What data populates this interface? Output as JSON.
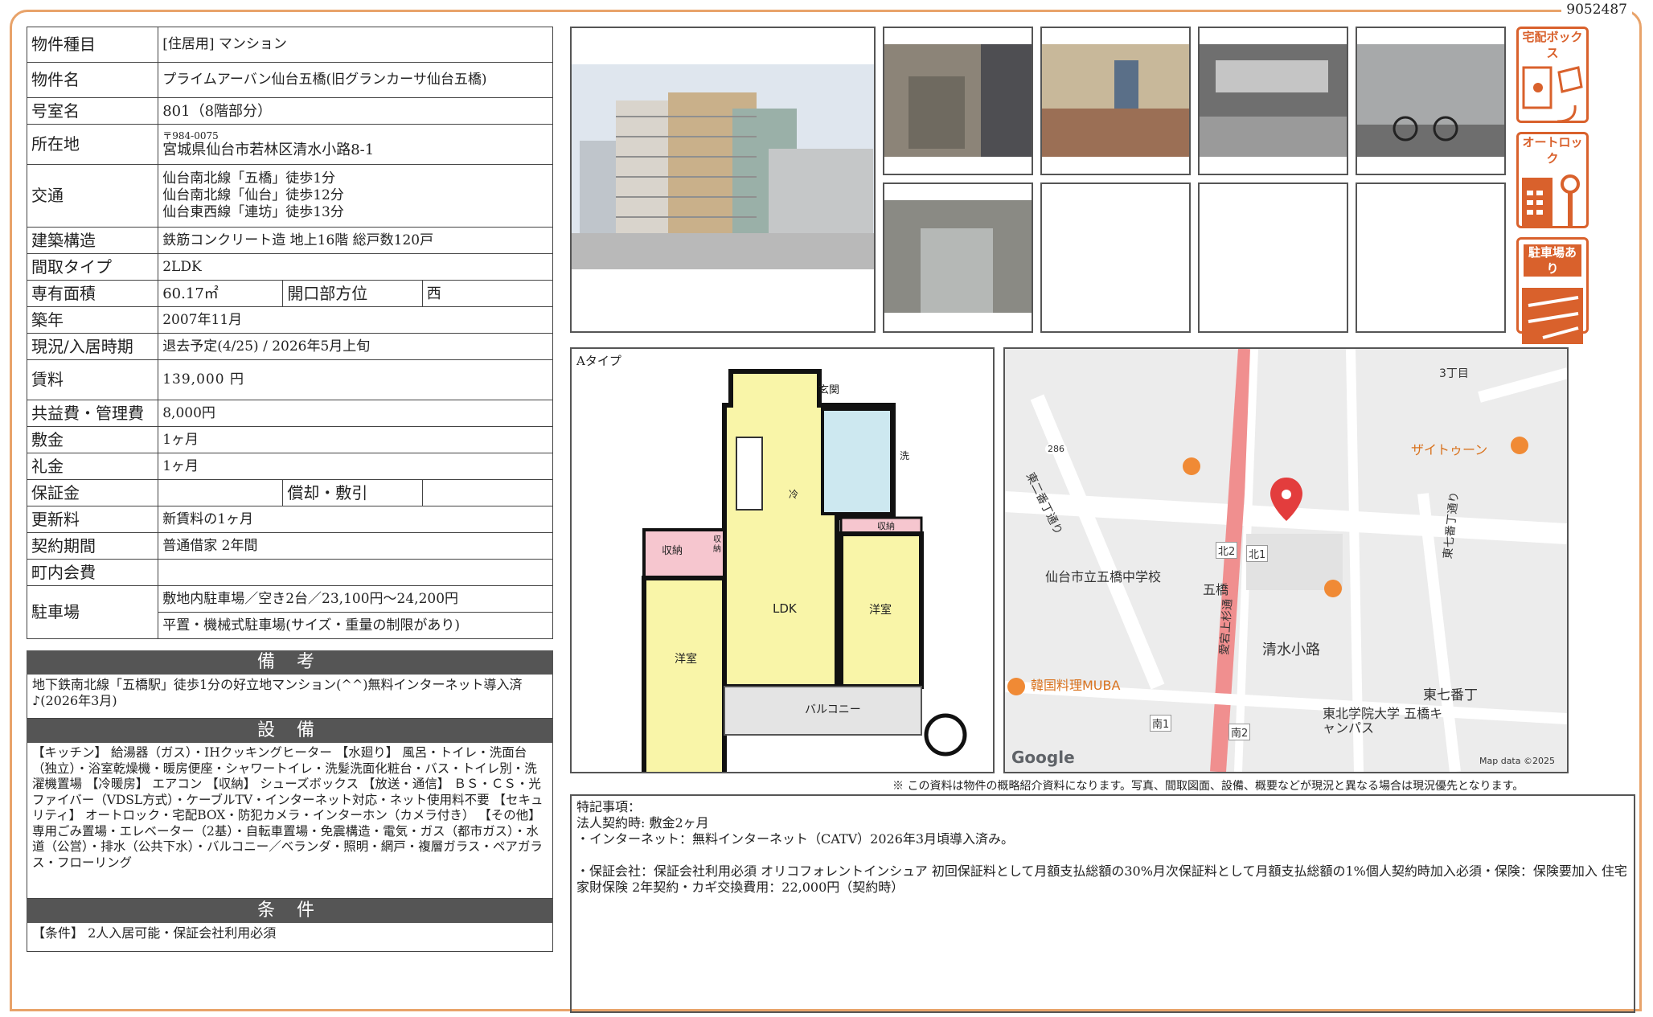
{
  "doc_id": "9052487",
  "spec": {
    "type_label": "物件種目",
    "type_value": "[住居用]  マンション",
    "name_label": "物件名",
    "name_value": "プライムアーバン仙台五橋(旧グランカーサ仙台五橋)",
    "room_label": "号室名",
    "room_value": "801（8階部分）",
    "addr_label": "所在地",
    "postal": "〒984-0075",
    "addr_value": "宮城県仙台市若林区清水小路8-1",
    "traffic_label": "交通",
    "traffic": [
      "仙台南北線「五橋」徒歩1分",
      "仙台南北線「仙台」徒歩12分",
      "仙台東西線「連坊」徒歩13分"
    ],
    "structure_label": "建築構造",
    "structure_value": "鉄筋コンクリート造  地上16階  総戸数120戸",
    "layout_label": "間取タイプ",
    "layout_value": "2LDK",
    "area_label": "専有面積",
    "area_value": "60.17㎡",
    "direction_label": "開口部方位",
    "direction_value": "西",
    "built_label": "築年",
    "built_value": "2007年11月",
    "status_label": "現況/入居時期",
    "status_value": "退去予定(4/25)  /  2026年5月上旬",
    "rent_label": "賃料",
    "rent_value": "139,000  円",
    "fee_label": "共益費・管理費",
    "fee_value": "8,000円",
    "deposit_label": "敷金",
    "deposit_value": "1ヶ月",
    "keymoney_label": "礼金",
    "keymoney_value": "1ヶ月",
    "guarantee_label": "保証金",
    "guarantee_value": "",
    "amort_label": "償却・敷引",
    "amort_value": "",
    "renewal_label": "更新料",
    "renewal_value": "新賃料の1ヶ月",
    "contract_label": "契約期間",
    "contract_value": "普通借家  2年間",
    "town_label": "町内会費",
    "town_value": "",
    "parking_label": "駐車場",
    "parking_value1": "敷地内駐車場／空き2台／23,100円〜24,200円",
    "parking_value2": "平置・機械式駐車場(サイズ・重量の制限があり)"
  },
  "remarks": {
    "title": "備 考",
    "text": "地下鉄南北線「五橋駅」徒歩1分の好立地マンション(^^)無料インターネット導入済♪(2026年3月)"
  },
  "equipment": {
    "title": "設 備",
    "text": "【キッチン】 給湯器（ガス）・IHクッキングヒーター 【水廻り】 風呂・トイレ・洗面台（独立）・浴室乾燥機・暖房便座・シャワートイレ・洗髪洗面化粧台・バス・トイレ別・洗濯機置場 【冷暖房】 エアコン 【収納】 シューズボックス 【放送・通信】 ＢＳ・ＣＳ・光ファイバー（VDSL方式）・ケーブルTV・インターネット対応・ネット使用料不要 【セキュリティ】 オートロック・宅配BOX・防犯カメラ・インターホン（カメラ付き） 【その他】 専用ごみ置場・エレベーター（2基）・自転車置場・免震構造・電気・ガス（都市ガス）・水道（公営）・排水（公共下水）・バルコニー／ベランダ・照明・網戸・複層ガラス・ペアガラス・フローリング"
  },
  "conditions": {
    "title": "条 件",
    "text": "【条件】 2人入居可能・保証会社利用必須"
  },
  "badges": [
    "宅配ボックス",
    "オートロック",
    "駐車場あり"
  ],
  "floorplan": {
    "type_label": "Aタイプ",
    "rooms": [
      "玄関",
      "洗",
      "冷",
      "収納",
      "収納",
      "収納",
      "LDK",
      "洋室",
      "洋室",
      "バルコニー"
    ]
  },
  "map": {
    "labels": [
      "3丁目",
      "ザイトゥーン",
      "仙台市立五橋中学校",
      "五橋",
      "北2",
      "北1",
      "清水小路",
      "韓国料理MUBA",
      "東七番丁",
      "東北学院大学 五橋キャンパス",
      "南1",
      "南2",
      "東二番丁通り",
      "東七番丁通り",
      "愛宕上杉通",
      "286",
      "Google",
      "Map data ©2025"
    ]
  },
  "disclaimer": "※ この資料は物件の概略紹介資料になります。写真、間取図面、設備、概要などが現況と異なる場合は現況優先となります。",
  "special_notes": [
    "特記事項：",
    "法人契約時: 敷金2ヶ月",
    "・インターネット：無料インターネット（CATV）2026年3月頃導入済み。",
    "",
    "・保証会社：保証会社利用必須  オリコフォレントインシュア  初回保証料として月額支払総額の30%月次保証料として月額支払総額の1%個人契約時加入必須・保険：保険要加入  住宅家財保険  2年契約・カギ交換費用：22,000円（契約時）"
  ]
}
